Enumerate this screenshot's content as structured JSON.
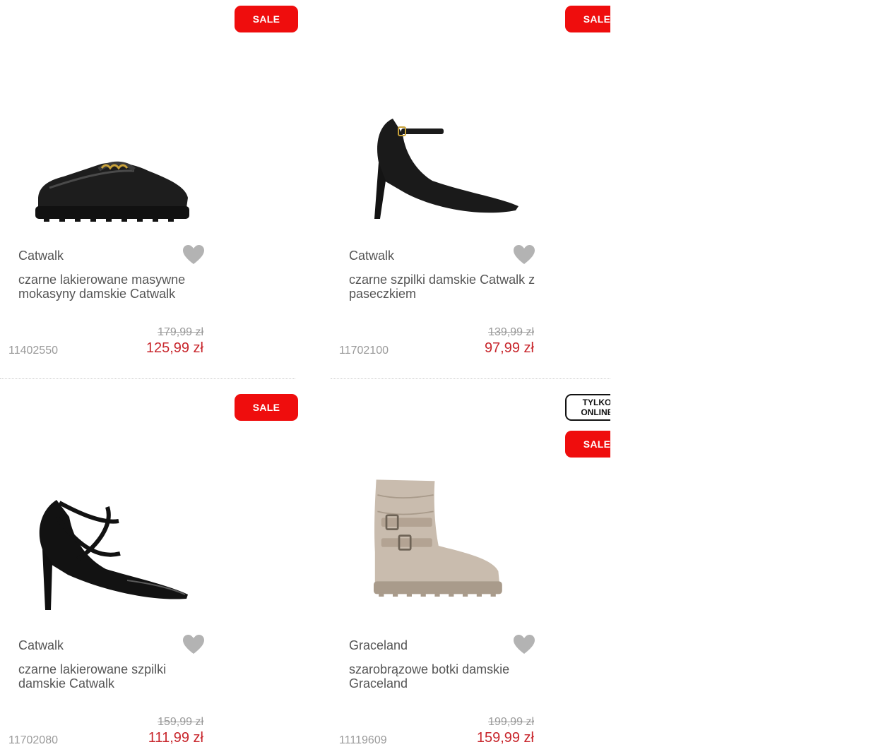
{
  "colors": {
    "sale": "#ef0d0d",
    "price_new": "#c8262c",
    "heart": "#b3b3b3"
  },
  "products": [
    {
      "brand": "Catwalk",
      "name": "czarne lakierowane masywne mokasyny damskie Catwalk",
      "old_price": "179,99 zł",
      "new_price": "125,99 zł",
      "sku": "11402550",
      "badges": [
        "SALE"
      ],
      "image": "black-patent-loafer"
    },
    {
      "brand": "Catwalk",
      "name": "czarne szpilki damskie Catwalk z paseczkiem",
      "old_price": "139,99 zł",
      "new_price": "97,99 zł",
      "sku": "11702100",
      "badges": [
        "SALE"
      ],
      "image": "black-ankle-strap-pump"
    },
    {
      "brand": "Catwalk",
      "name": "czarne lakierowane szpilki damskie Catwalk",
      "old_price": "159,99 zł",
      "new_price": "111,99 zł",
      "sku": "11702080",
      "badges": [
        "SALE"
      ],
      "image": "black-strappy-heel"
    },
    {
      "brand": "Graceland",
      "name": "szarobrązowe botki damskie Graceland",
      "old_price": "199,99 zł",
      "new_price": "159,99 zł",
      "sku": "11119609",
      "badges": [
        "TYLKO ONLINE",
        "SALE"
      ],
      "image": "taupe-slouch-boot"
    }
  ],
  "badge_online": {
    "line1": "TYLKO",
    "line2": "ONLINE"
  }
}
